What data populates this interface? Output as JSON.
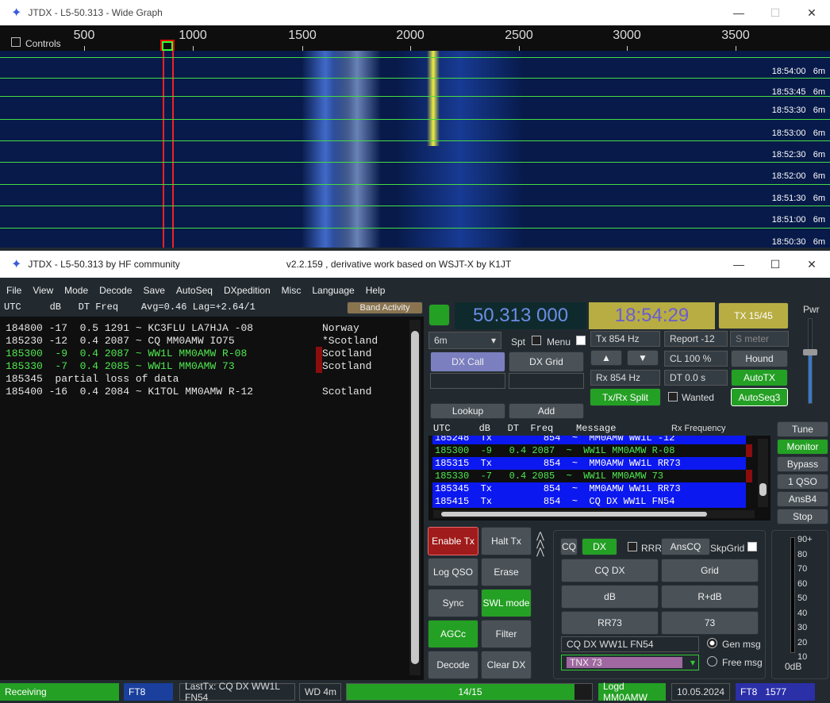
{
  "wide_graph": {
    "title": "JTDX - L5-50.313 - Wide Graph",
    "controls_label": "Controls",
    "freq_ticks": [
      "500",
      "1000",
      "1500",
      "2000",
      "2500",
      "3000",
      "3500"
    ],
    "times": [
      "18:54:00",
      "18:53:45",
      "18:53:30",
      "18:53:00",
      "18:52:30",
      "18:52:00",
      "18:51:30",
      "18:51:00",
      "18:50:30"
    ],
    "band": "6m"
  },
  "main": {
    "title": "JTDX - L5-50.313  by HF community",
    "subtitle": "v2.2.159 , derivative work based on WSJT-X by K1JT"
  },
  "menu": [
    "File",
    "View",
    "Mode",
    "Decode",
    "Save",
    "AutoSeq",
    "DXpedition",
    "Misc",
    "Language",
    "Help"
  ],
  "band_activity": {
    "header": "UTC     dB   DT Freq    Avg=0.46 Lag=+2.64/1",
    "button": "Band Activity",
    "rows": [
      {
        "t": "184800 -17  0.5 1291 ~ KC3FLU LA7HJA -08",
        "c": "Norway",
        "color": "#e6e6e6",
        "mark": false
      },
      {
        "t": "185230 -12  0.4 2087 ~ CQ MM0AMW IO75",
        "c": "*Scotland",
        "color": "#e6e6e6",
        "mark": false
      },
      {
        "t": "185300  -9  0.4 2087 ~ WW1L MM0AMW R-08",
        "c": "Scotland",
        "color": "#4fe84f",
        "mark": true
      },
      {
        "t": "185330  -7  0.4 2085 ~ WW1L MM0AMW 73",
        "c": "Scotland",
        "color": "#4fe84f",
        "mark": true
      },
      {
        "t": "185345  partial loss of data",
        "c": "",
        "color": "#e6e6e6",
        "mark": false
      },
      {
        "t": "185400 -16  0.4 2084 ~ K1TOL MM0AMW R-12",
        "c": "Scotland",
        "color": "#e6e6e6",
        "mark": false
      }
    ]
  },
  "controls": {
    "frequency": "50.313 000",
    "clock": "18:54:29",
    "tx_period": "TX 15/45",
    "band": "6m",
    "spt": "Spt",
    "menu": "Menu",
    "dx_call": "DX Call",
    "dx_grid": "DX Grid",
    "lookup": "Lookup",
    "add": "Add",
    "tx_hz": "Tx  854  Hz",
    "rx_hz": "Rx  854  Hz",
    "report": "Report -12",
    "smeter": "S meter",
    "cl": "CL  100 %",
    "dt": "DT 0.0 s",
    "hound": "Hound",
    "autotx": "AutoTX",
    "txrx_split": "Tx/Rx Split",
    "wanted": "Wanted",
    "autoseq3": "AutoSeq3",
    "pwr": "Pwr"
  },
  "rx_freq": {
    "header": "UTC     dB   DT  Freq    Message",
    "title": "Rx Frequency",
    "rows": [
      {
        "t": "185248  Tx         854  ~  MM0AMW WW1L -12",
        "type": "tx"
      },
      {
        "t": "185300  -9   0.4 2087  ~  WW1L MM0AMW R-08",
        "type": "rx"
      },
      {
        "t": "185315  Tx         854  ~  MM0AMW WW1L RR73",
        "type": "tx"
      },
      {
        "t": "185330  -7   0.4 2085  ~  WW1L MM0AMW 73",
        "type": "rx"
      },
      {
        "t": "185345  Tx         854  ~  MM0AMW WW1L RR73",
        "type": "tx"
      },
      {
        "t": "185415  Tx         854  ~  CQ DX WW1L FN54",
        "type": "tx"
      }
    ]
  },
  "side_buttons": [
    "Tune",
    "Monitor",
    "Bypass",
    "1 QSO",
    "AnsB4",
    "Stop"
  ],
  "lower": {
    "enable_tx": "Enable Tx",
    "halt_tx": "Halt Tx",
    "log_qso": "Log QSO",
    "erase": "Erase",
    "sync": "Sync",
    "swl": "SWL mode",
    "agcc": "AGCc",
    "filter": "Filter",
    "decode": "Decode",
    "clear_dx": "Clear DX"
  },
  "macros": {
    "cq": "CQ",
    "dx": "DX",
    "rrr": "RRR",
    "anscq": "AnsCQ",
    "skpgrid": "SkpGrid",
    "buttons": [
      "CQ DX",
      "Grid",
      "dB",
      "R+dB",
      "RR73",
      "73"
    ],
    "msg1": "CQ DX WW1L FN54",
    "msg2": "TNX 73",
    "gen": "Gen msg",
    "free": "Free msg"
  },
  "meter": {
    "labels": [
      "90+",
      "80",
      "70",
      "60",
      "50",
      "40",
      "30",
      "20",
      "10"
    ],
    "zero": "0dB"
  },
  "status": {
    "state": "Receiving",
    "mode": "FT8",
    "lasttx": "LastTx: CQ DX WW1L FN54",
    "wd": "WD 4m",
    "progress": "14/15",
    "progress_fraction": 0.93,
    "logd": "Logd MM0AMW",
    "date": "10.05.2024",
    "modefreq": "FT8   1577"
  }
}
